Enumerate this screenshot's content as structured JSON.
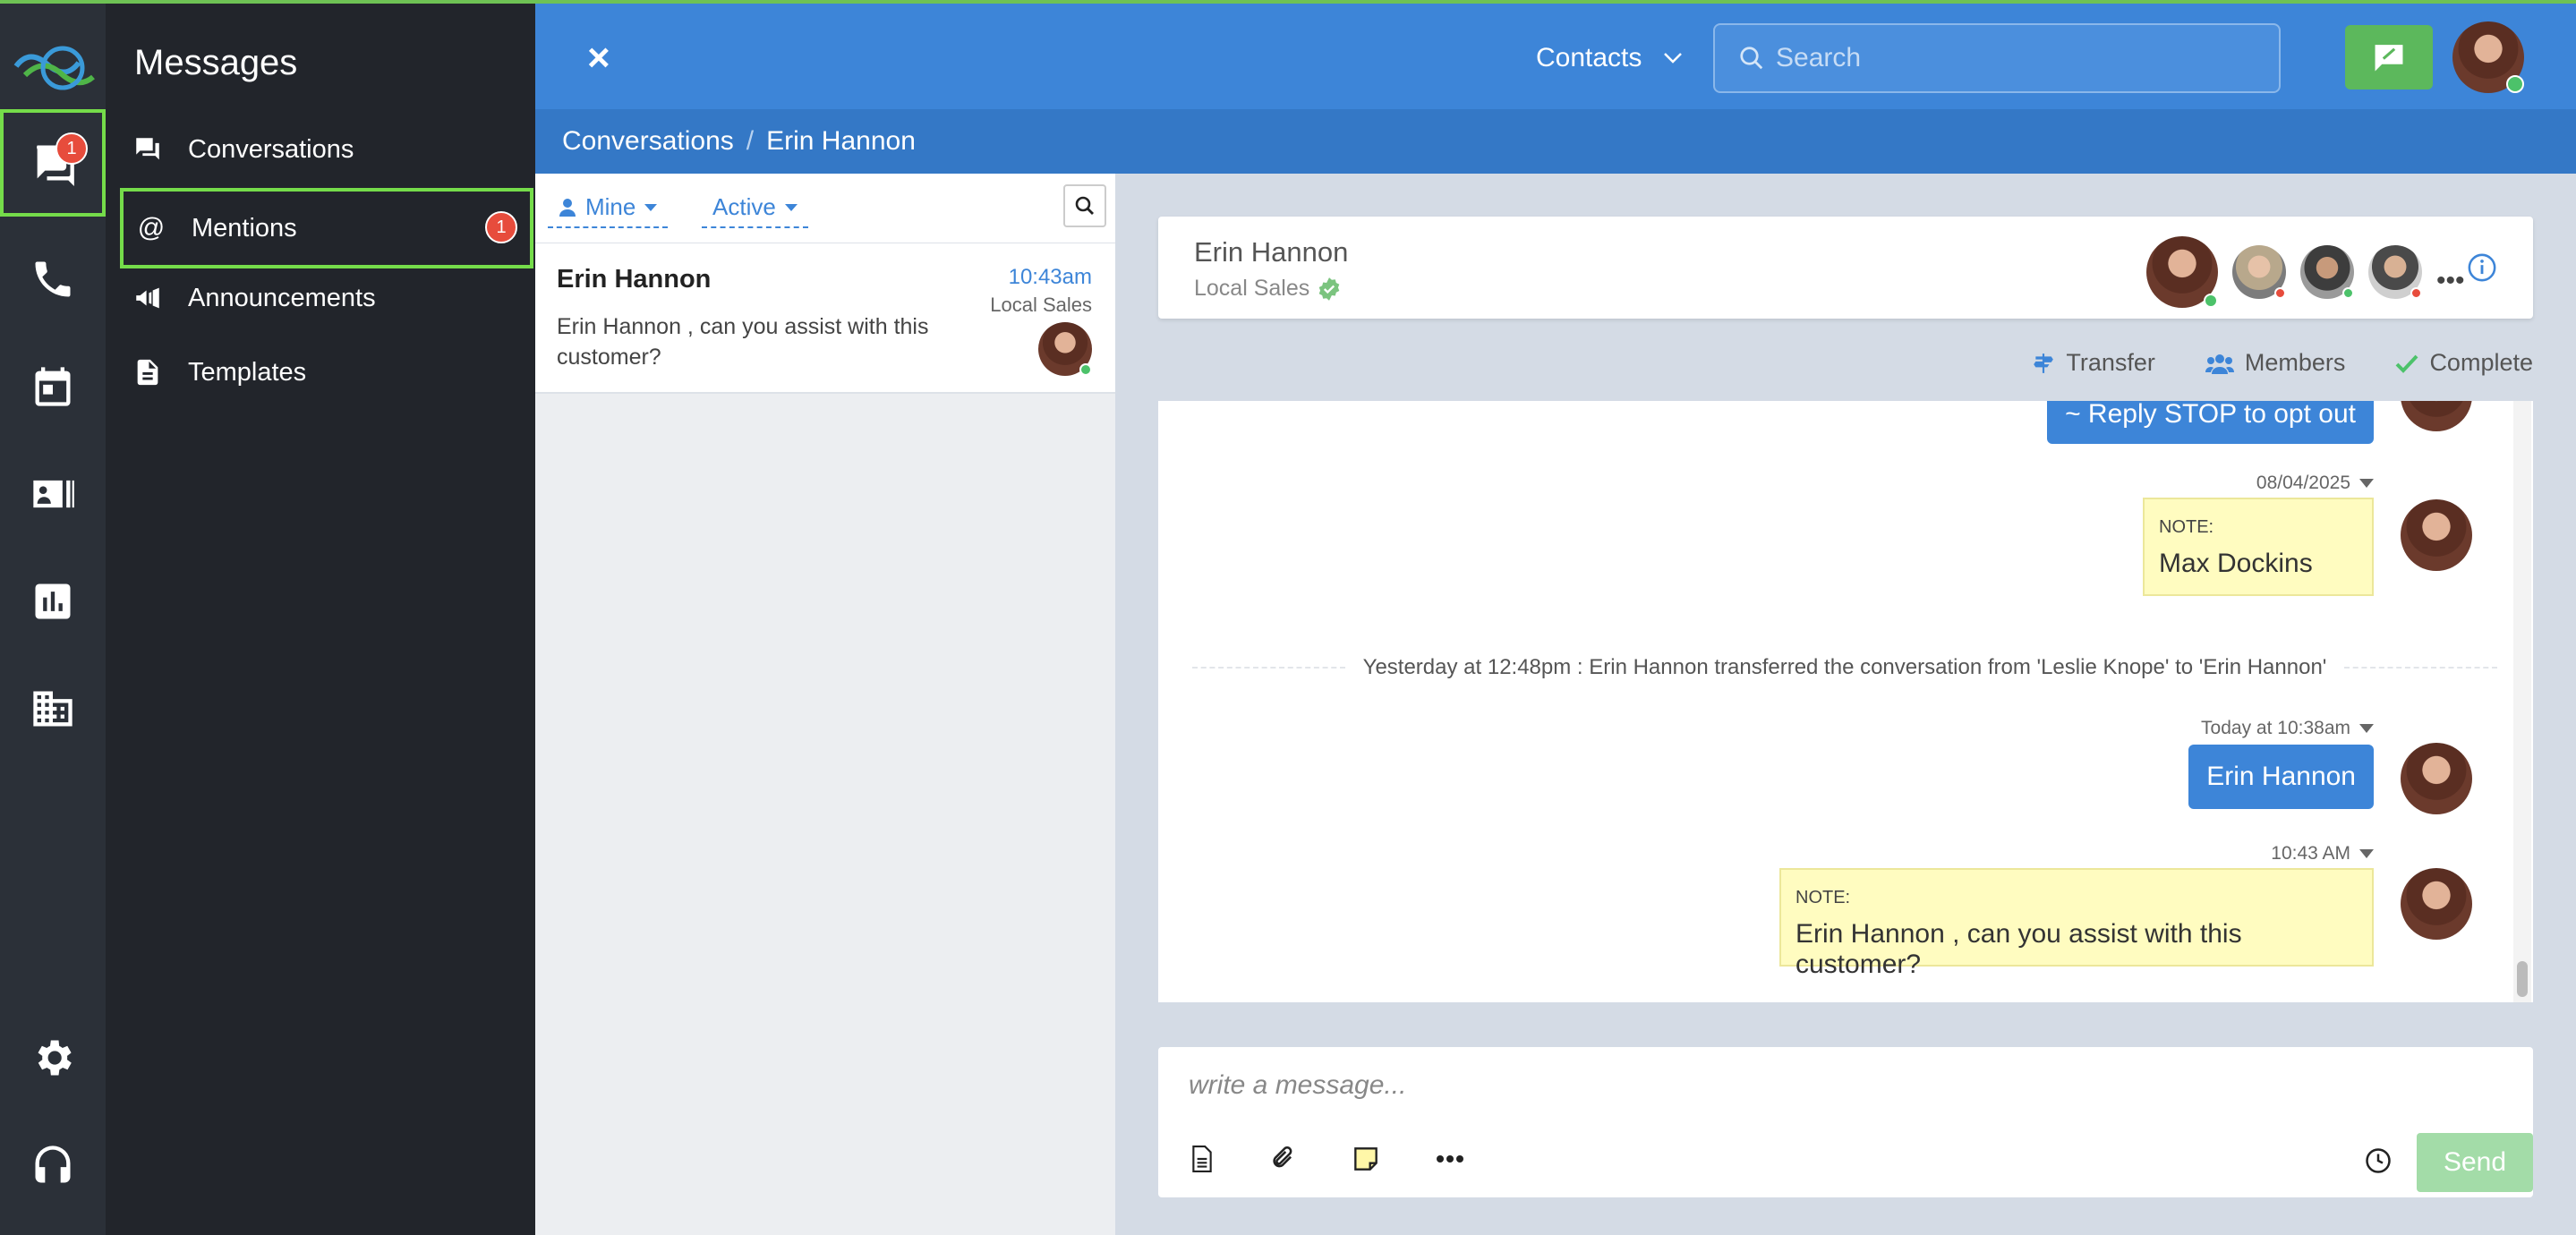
{
  "rail": {
    "messages_badge": "1",
    "icons": [
      "chat-icon",
      "phone-icon",
      "calendar-icon",
      "contact-card-icon",
      "chart-icon",
      "building-icon",
      "gear-icon",
      "headset-icon"
    ]
  },
  "menu": {
    "title": "Messages",
    "items": [
      {
        "label": "Conversations",
        "icon": "conversations-icon"
      },
      {
        "label": "Mentions",
        "icon": "at-icon",
        "count": "1"
      },
      {
        "label": "Announcements",
        "icon": "megaphone-icon"
      },
      {
        "label": "Templates",
        "icon": "document-icon"
      }
    ]
  },
  "header": {
    "close": "×",
    "contacts_label": "Contacts",
    "search_placeholder": "Search"
  },
  "breadcrumb": {
    "root": "Conversations",
    "sep": "/",
    "current": "Erin Hannon"
  },
  "list": {
    "filter_mine": "Mine",
    "filter_active": "Active",
    "conversations": [
      {
        "name": "Erin Hannon",
        "time": "10:43am",
        "dept": "Local Sales",
        "preview": "Erin Hannon , can you assist with this customer?"
      }
    ]
  },
  "chat": {
    "name": "Erin Hannon",
    "dept": "Local Sales",
    "more": "•••",
    "actions": {
      "transfer": "Transfer",
      "members": "Members",
      "complete": "Complete"
    },
    "messages": {
      "stop_text": "~ Reply STOP to opt out",
      "note1_stamp": "08/04/2025",
      "note1_label": "NOTE:",
      "note1_text": "Max Dockins",
      "system": "Yesterday at 12:48pm : Erin Hannon transferred the conversation from 'Leslie Knope' to 'Erin Hannon'",
      "msg_stamp": "Today at 10:38am",
      "msg_text": "Erin Hannon",
      "note2_stamp": "10:43 AM",
      "note2_label": "NOTE:",
      "note2_text": "Erin Hannon , can you assist with this customer?"
    },
    "composer_placeholder": "write a message...",
    "send_label": "Send"
  },
  "colors": {
    "primary": "#3d85d8",
    "header_dark": "#3478c6",
    "rail": "#2b3038",
    "menu": "#22252b",
    "highlight": "#75dc4a",
    "send_disabled": "#a3dca8",
    "note_bg": "#fffcc0",
    "badge": "#e74c3c"
  }
}
